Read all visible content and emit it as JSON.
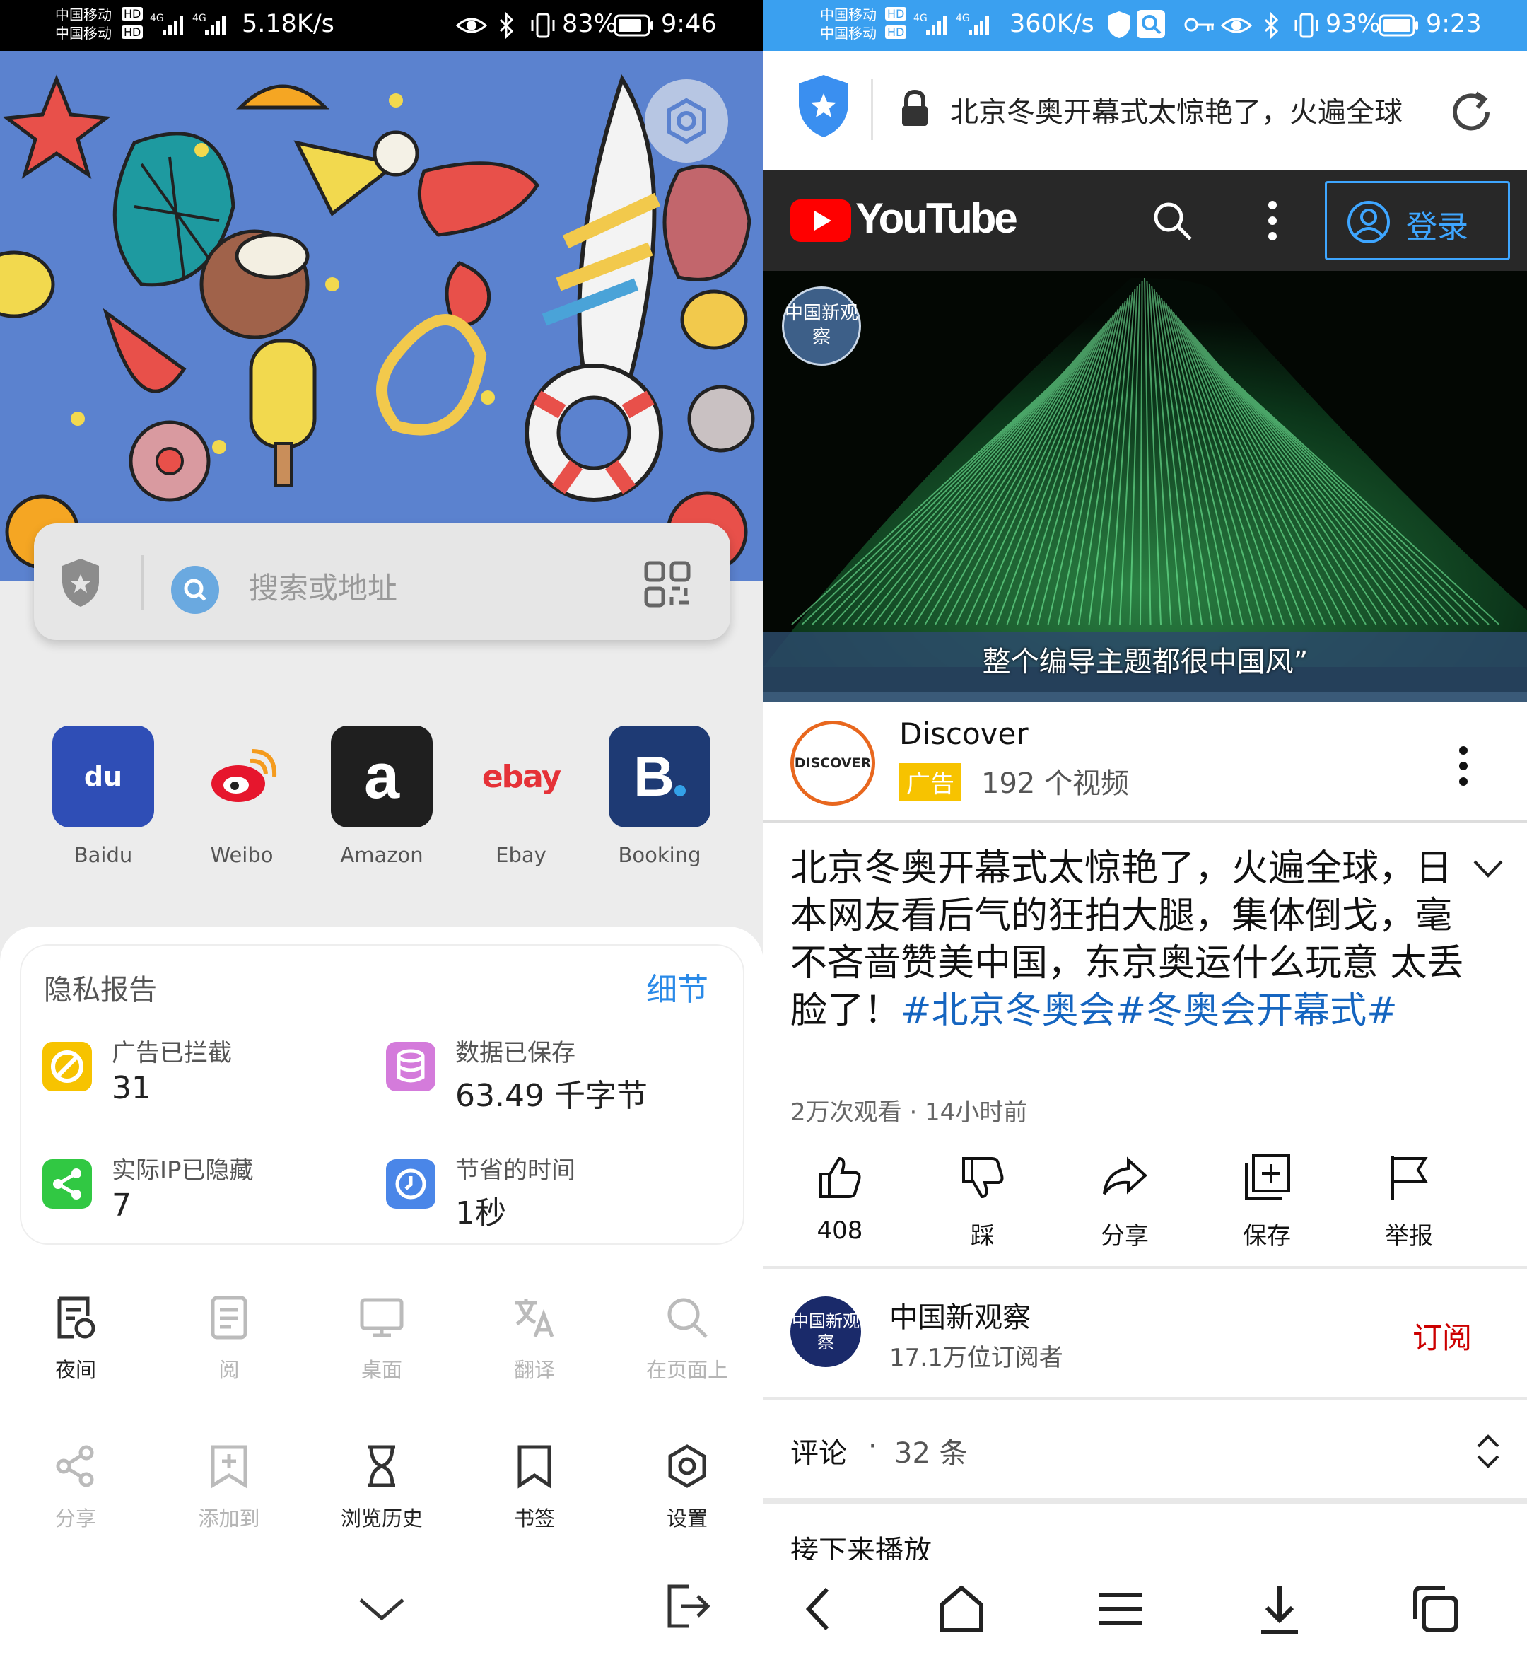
{
  "left": {
    "status": {
      "carrier1": "中国移动",
      "carrier2": "中国移动",
      "hd": "HD",
      "net": "4G",
      "speed": "5.18K/s",
      "battery": "83%",
      "time": "9:46"
    },
    "search": {
      "placeholder": "搜索或地址"
    },
    "shortcuts": [
      {
        "label": "Baidu",
        "glyph": "du",
        "color": "#2f4eb6"
      },
      {
        "label": "Weibo",
        "glyph": "",
        "color": "#e6162d"
      },
      {
        "label": "Amazon",
        "glyph": "a",
        "color": "#1f1f1f"
      },
      {
        "label": "Ebay",
        "glyph": "ebay",
        "color": "#e53238"
      },
      {
        "label": "Booking",
        "glyph": "B",
        "color": "#1e3a74"
      }
    ],
    "privacy": {
      "title": "隐私报告",
      "details": "细节",
      "items": [
        {
          "label": "广告已拦截",
          "value": "31",
          "color": "#f7c300"
        },
        {
          "label": "数据已保存",
          "value": "63.49 千字节",
          "color": "#d47bdb"
        },
        {
          "label": "实际IP已隐藏",
          "value": "7",
          "color": "#31c843"
        },
        {
          "label": "节省的时间",
          "value": "1秒",
          "color": "#4a86e8"
        }
      ]
    },
    "menu": [
      {
        "label": "夜间",
        "icon": "night-mode-icon",
        "enabled": true
      },
      {
        "label": "阅",
        "icon": "reader-icon",
        "enabled": false
      },
      {
        "label": "桌面",
        "icon": "desktop-icon",
        "enabled": false
      },
      {
        "label": "翻译",
        "icon": "translate-icon",
        "enabled": false
      },
      {
        "label": "在页面上",
        "icon": "find-in-page-icon",
        "enabled": false
      },
      {
        "label": "分享",
        "icon": "share-icon",
        "enabled": false
      },
      {
        "label": "添加到",
        "icon": "add-to-icon",
        "enabled": false
      },
      {
        "label": "浏览历史",
        "icon": "history-icon",
        "enabled": true
      },
      {
        "label": "书签",
        "icon": "bookmark-icon",
        "enabled": true
      },
      {
        "label": "设置",
        "icon": "settings-icon",
        "enabled": true
      }
    ]
  },
  "right": {
    "status": {
      "carrier1": "中国移动",
      "carrier2": "中国移动",
      "hd": "HD",
      "net": "4G",
      "speed": "360K/s",
      "battery": "93%",
      "time": "9:23"
    },
    "url": "北京冬奥开幕式太惊艳了，火遍全球",
    "youtube": {
      "logo": "YouTube",
      "login": "登录"
    },
    "video": {
      "watermark": "中国新观察",
      "subtitle": "整个编导主题都很中国风”"
    },
    "ad": {
      "brand_logo": "DISCOVER",
      "name": "Discover",
      "badge": "广告",
      "videos": "192 个视频"
    },
    "title": {
      "text": "北京冬奥开幕式太惊艳了，火遍全球，日本网友看后气的狂拍大腿，集体倒戈，毫不吝啬赞美中国，东京奥运什么玩意 太丢脸了！",
      "hashtags": "#北京冬奥会#冬奥会开幕式#"
    },
    "meta": "2万次观看 · 14小时前",
    "actions": [
      {
        "label": "408",
        "icon": "like-icon"
      },
      {
        "label": "踩",
        "icon": "dislike-icon"
      },
      {
        "label": "分享",
        "icon": "share-icon"
      },
      {
        "label": "保存",
        "icon": "save-icon"
      },
      {
        "label": "举报",
        "icon": "report-flag-icon"
      }
    ],
    "channel": {
      "name": "中国新观察",
      "subs": "17.1万位订阅者",
      "subscribe": "订阅",
      "avatar_text": "中国新观察"
    },
    "comments": {
      "label": "评论",
      "count": "32 条"
    },
    "up_next": "接下来播放"
  }
}
